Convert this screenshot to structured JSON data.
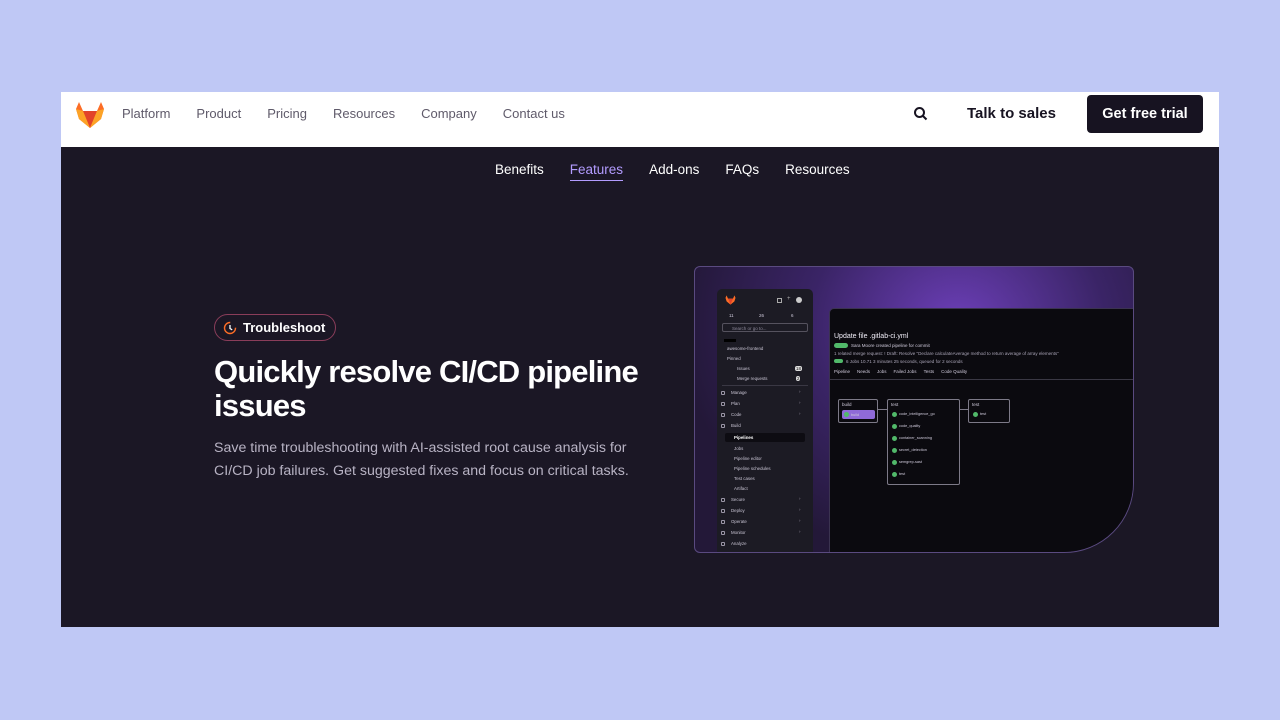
{
  "topnav": {
    "links": [
      "Platform",
      "Product",
      "Pricing",
      "Resources",
      "Company",
      "Contact us"
    ],
    "sales_label": "Talk to sales",
    "trial_label": "Get free trial"
  },
  "subnav": {
    "items": [
      "Benefits",
      "Features",
      "Add-ons",
      "FAQs",
      "Resources"
    ],
    "active": "Features"
  },
  "hero": {
    "badge": "Troubleshoot",
    "title": "Quickly resolve CI/CD pipeline issues",
    "description": "Save time troubleshooting with AI-assisted root cause analysis for CI/CD job failures. Get suggested fixes and focus on critical tasks."
  },
  "mock": {
    "search_placeholder": "Search or go to...",
    "project": "awesome-frontend",
    "sidebar": {
      "pinned": "Pinned",
      "issues": "Issues",
      "issues_count": "18",
      "merge_requests": "Merge requests",
      "mr_count": "2",
      "groups": [
        "Manage",
        "Plan",
        "Code",
        "Build"
      ],
      "build_items": [
        "Pipelines",
        "Jobs",
        "Pipeline editor",
        "Pipeline schedules",
        "Test cases",
        "Artifact"
      ],
      "bottom": [
        "Secure",
        "Deploy",
        "Operate",
        "Monitor",
        "Analyze"
      ],
      "counts": [
        "11",
        "26",
        "6"
      ]
    },
    "pipeline": {
      "title": "Update file .gitlab-ci.yml",
      "meta": "Sara Moore created pipeline for commit",
      "meta2": "1 related merge request: ! Draft: Resolve \"Declare calculateAverage method to return average of array elements\"",
      "stats": "6 Jobs  10.71  3 minutes 25 seconds, queued for 2 seconds",
      "tabs": [
        "Pipeline",
        "Needs",
        "Jobs",
        "Failed Jobs",
        "Tests",
        "Code Quality"
      ],
      "tab_counts": [
        "6",
        "2",
        "0"
      ],
      "stages": [
        {
          "name": "build",
          "jobs": [
            "build"
          ]
        },
        {
          "name": "test",
          "jobs": [
            "code_intelligence_go",
            "code_quality",
            "container_scanning",
            "secret_detection",
            "semgrep-sast",
            "test"
          ]
        },
        {
          "name": "test",
          "jobs": [
            "test"
          ]
        }
      ]
    }
  },
  "colors": {
    "page_bg": "#bfc8f5",
    "dark_bg": "#1b1725",
    "accent": "#b39cff",
    "button": "#171321",
    "logo_orange": "#e2432a"
  }
}
